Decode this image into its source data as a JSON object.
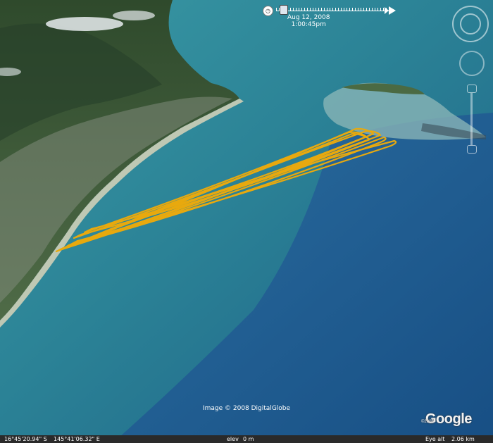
{
  "time_slider": {
    "date": "Aug 12, 2008",
    "time": "1:00:45pm"
  },
  "attribution": "Image © 2008 DigitalGlobe",
  "logo": {
    "text": "Google",
    "year": "©2008"
  },
  "status_bar": {
    "lat": "16°45'20.94\" S",
    "lon": "145°41'06.32\" E",
    "elev_label": "elev",
    "elev_value": "0 m",
    "eye_alt_label": "Eye alt",
    "eye_alt_value": "2.06 km"
  },
  "colors": {
    "track": "#e8a90e",
    "shallow_water": "#2f8da0",
    "deep_water": "#1f5b92",
    "land": "#3d5d36"
  },
  "icons": [
    "clock-icon",
    "play-icon",
    "navigation-ring-icon",
    "look-ring-icon",
    "zoom-slider-icon"
  ]
}
